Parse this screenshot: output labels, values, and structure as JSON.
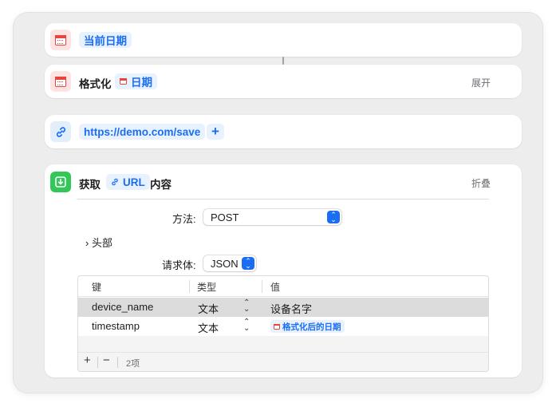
{
  "actions": {
    "current_date": {
      "icon": "calendar-icon",
      "token": "当前日期"
    },
    "format_date": {
      "label": "格式化",
      "token": "日期",
      "expand_label": "展开"
    },
    "url": {
      "icon": "link-icon",
      "token": "https://demo.com/save",
      "add_label": "+"
    },
    "get_contents": {
      "icon": "download-icon",
      "label_prefix": "获取",
      "token": "URL",
      "label_suffix": "内容",
      "collapse_label": "折叠",
      "method": {
        "label": "方法:",
        "value": "POST"
      },
      "headers": {
        "label": "头部"
      },
      "body": {
        "label": "请求体:",
        "value": "JSON"
      },
      "table": {
        "headers": [
          "键",
          "类型",
          "值"
        ],
        "rows": [
          {
            "key": "device_name",
            "type": "文本",
            "value": "设备名字",
            "selected": true
          },
          {
            "key": "timestamp",
            "type": "文本",
            "value_token": "格式化后的日期",
            "selected": false
          }
        ],
        "footer": {
          "add": "+",
          "remove": "−",
          "count": "2项"
        }
      }
    }
  },
  "colors": {
    "accent": "#1b6ef3",
    "token_bg": "#e8f1fe",
    "calendar_red": "#e8453c",
    "download_green": "#33c759"
  }
}
